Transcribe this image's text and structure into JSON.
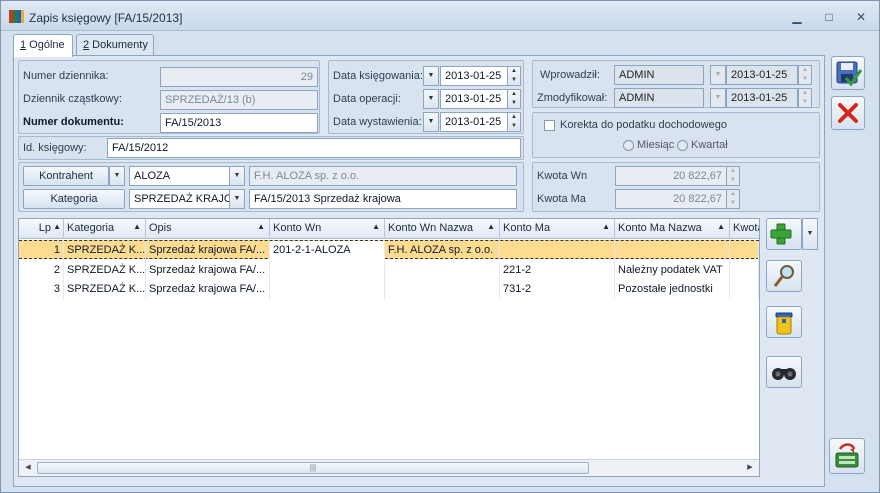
{
  "window": {
    "title": "Zapis księgowy [FA/15/2013]",
    "minimize": "▁",
    "restore": "□",
    "close": "✕",
    "accent": "#4d6f95"
  },
  "tabs": [
    {
      "num": "1",
      "label": " Ogólne"
    },
    {
      "num": "2",
      "label": " Dokumenty"
    }
  ],
  "form": {
    "numer_dziennika": {
      "label": "Numer dziennika:",
      "value": "29"
    },
    "dziennik_czastkowy": {
      "label": "Dziennik cząstkowy:",
      "value": "SPRZEDAŻ/13 (b)"
    },
    "numer_dokumentu": {
      "label": "Numer dokumentu:",
      "value": "FA/15/2013"
    },
    "id_ksiegowy": {
      "label": "Id. księgowy:",
      "value": "FA/15/2012"
    },
    "data_ksiegowania": {
      "label": "Data księgowania:",
      "value": "2013-01-25"
    },
    "data_operacji": {
      "label": "Data operacji:",
      "value": "2013-01-25"
    },
    "data_wystawienia": {
      "label": "Data wystawienia:",
      "value": "2013-01-25"
    },
    "wprowadzil": {
      "label": "Wprowadził:",
      "user": "ADMIN",
      "date": "2013-01-25"
    },
    "zmodyfikowal": {
      "label": "Zmodyfikował:",
      "user": "ADMIN",
      "date": "2013-01-25"
    },
    "korekta": {
      "label": "Korekta do podatku dochodowego",
      "checked": false
    },
    "miesiac": "Miesiąc",
    "kwartal": "Kwartał",
    "kontrahent": {
      "button": "Kontrahent",
      "code": "ALOZA",
      "name": "F.H. ALOZA sp. z o.o."
    },
    "kategoria": {
      "button": "Kategoria",
      "code": "SPRZEDAŻ KRAJOW",
      "desc": "FA/15/2013 Sprzedaż krajowa"
    },
    "kwota_wn": {
      "label": "Kwota Wn",
      "value": "20 822,67"
    },
    "kwota_ma": {
      "label": "Kwota Ma",
      "value": "20 822,67"
    }
  },
  "grid": {
    "columns": [
      "Lp",
      "Kategoria",
      "Opis",
      "Konto Wn",
      "Konto Wn Nazwa",
      "Konto Ma",
      "Konto Ma Nazwa",
      "Kwota"
    ],
    "rows": [
      {
        "lp": "1",
        "kategoria": "SPRZEDAŻ K...",
        "opis": "Sprzedaż krajowa FA/...",
        "konto_wn": "201-2-1-ALOZA",
        "konto_wn_nazwa": "F.H. ALOZA sp. z o.o.",
        "konto_ma": "",
        "konto_ma_nazwa": "",
        "kwota": ""
      },
      {
        "lp": "2",
        "kategoria": "SPRZEDAŻ K...",
        "opis": "Sprzedaż krajowa FA/...",
        "konto_wn": "",
        "konto_wn_nazwa": "",
        "konto_ma": "221-2",
        "konto_ma_nazwa": "Należny podatek VAT",
        "kwota": ""
      },
      {
        "lp": "3",
        "kategoria": "SPRZEDAŻ K...",
        "opis": "Sprzedaż krajowa FA/...",
        "konto_wn": "",
        "konto_wn_nazwa": "",
        "konto_ma": "731-2",
        "konto_ma_nazwa": "Pozostałe jednostki",
        "kwota": ""
      }
    ],
    "selected_row_color": "#fddc8f"
  },
  "icons": {
    "save": "save-icon",
    "cancel": "cancel-icon",
    "add": "add-icon",
    "edit": "magnifier-icon",
    "delete": "trash-icon",
    "find": "binoculars-icon",
    "export": "export-icon"
  }
}
